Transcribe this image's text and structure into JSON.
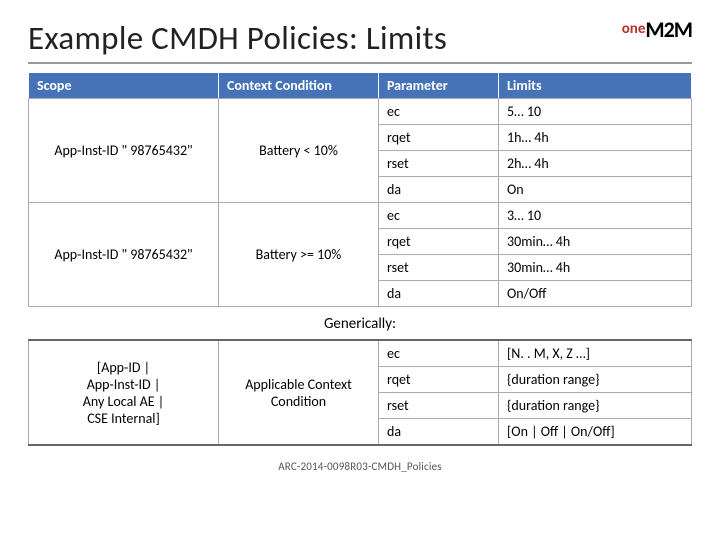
{
  "title": "Example CMDH Policies: Limits",
  "logo": {
    "one": "one",
    "m2m": "M2M"
  },
  "headers": {
    "scope": "Scope",
    "context": "Context Condition",
    "parameter": "Parameter",
    "limits": "Limits"
  },
  "groups": [
    {
      "scope": "App-Inst-ID \" 98765432\"",
      "context": "Battery < 10%",
      "rows": [
        {
          "param": "ec",
          "limit": "5… 10"
        },
        {
          "param": "rqet",
          "limit": "1h… 4h"
        },
        {
          "param": "rset",
          "limit": "2h… 4h"
        },
        {
          "param": "da",
          "limit": "On"
        }
      ]
    },
    {
      "scope": "App-Inst-ID \" 98765432\"",
      "context": "Battery >= 10%",
      "rows": [
        {
          "param": "ec",
          "limit": "3… 10"
        },
        {
          "param": "rqet",
          "limit": "30min… 4h"
        },
        {
          "param": "rset",
          "limit": "30min… 4h"
        },
        {
          "param": "da",
          "limit": "On/Off"
        }
      ]
    }
  ],
  "generically_label": "Generically:",
  "generic": {
    "scope": "[App-ID |\nApp-Inst-ID |\nAny Local AE |\nCSE Internal]",
    "context": "Applicable Context Condition",
    "rows": [
      {
        "param": "ec",
        "limit": "[N. . M, X, Z …]"
      },
      {
        "param": "rqet",
        "limit": "{duration range}"
      },
      {
        "param": "rset",
        "limit": "{duration range}"
      },
      {
        "param": "da",
        "limit": "[On | Off | On/Off]"
      }
    ]
  },
  "footer": "ARC-2014-0098R03-CMDH_Policies"
}
